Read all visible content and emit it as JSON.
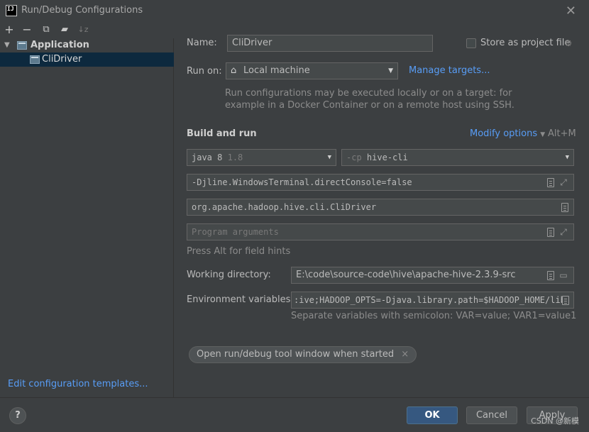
{
  "window": {
    "title": "Run/Debug Configurations",
    "logo_text": "IJ",
    "close_icon": "close-icon"
  },
  "toolbar": {
    "icons": [
      "add-icon",
      "remove-icon",
      "copy-icon",
      "new-folder-icon",
      "sort-icon"
    ],
    "sort_label": "↓z"
  },
  "tree": {
    "items": [
      {
        "label": "Application",
        "level": 0,
        "expanded": true
      },
      {
        "label": "CliDriver",
        "level": 1,
        "selected": true
      }
    ]
  },
  "sidebar": {
    "edit_templates": "Edit configuration templates..."
  },
  "form": {
    "name_label": "Name:",
    "name_value": "CliDriver",
    "store_label": "Store as project file",
    "store_checked": false,
    "run_on_label": "Run on:",
    "run_on_value": "Local machine",
    "manage_targets": "Manage targets...",
    "run_on_hint_line1": "Run configurations may be executed locally or on a target: for",
    "run_on_hint_line2": "example in a Docker Container or on a remote host using SSH.",
    "build_run_heading": "Build and run",
    "modify_options": "Modify options",
    "modify_shortcut": "Alt+M",
    "jdk_name": "java 8",
    "jdk_version": "1.8",
    "cp_flag": "-cp",
    "cp_module": "hive-cli",
    "vm_options": "-Djline.WindowsTerminal.directConsole=false",
    "main_class": "org.apache.hadoop.hive.cli.CliDriver",
    "program_args_placeholder": "Program arguments",
    "field_hint": "Press Alt for field hints",
    "working_dir_label": "Working directory:",
    "working_dir_value": "E:\\code\\source-code\\hive\\apache-hive-2.3.9-src",
    "env_label": "Environment variables:",
    "env_value": ":ive;HADOOP_OPTS=-Djava.library.path=$HADOOP_HOME/lib",
    "env_hint": "Separate variables with semicolon: VAR=value; VAR1=value1",
    "tool_window_pill": "Open run/debug tool window when started"
  },
  "buttons": {
    "help": "?",
    "ok": "OK",
    "cancel": "Cancel",
    "apply": "Apply"
  },
  "watermark": "CSDN @新模"
}
